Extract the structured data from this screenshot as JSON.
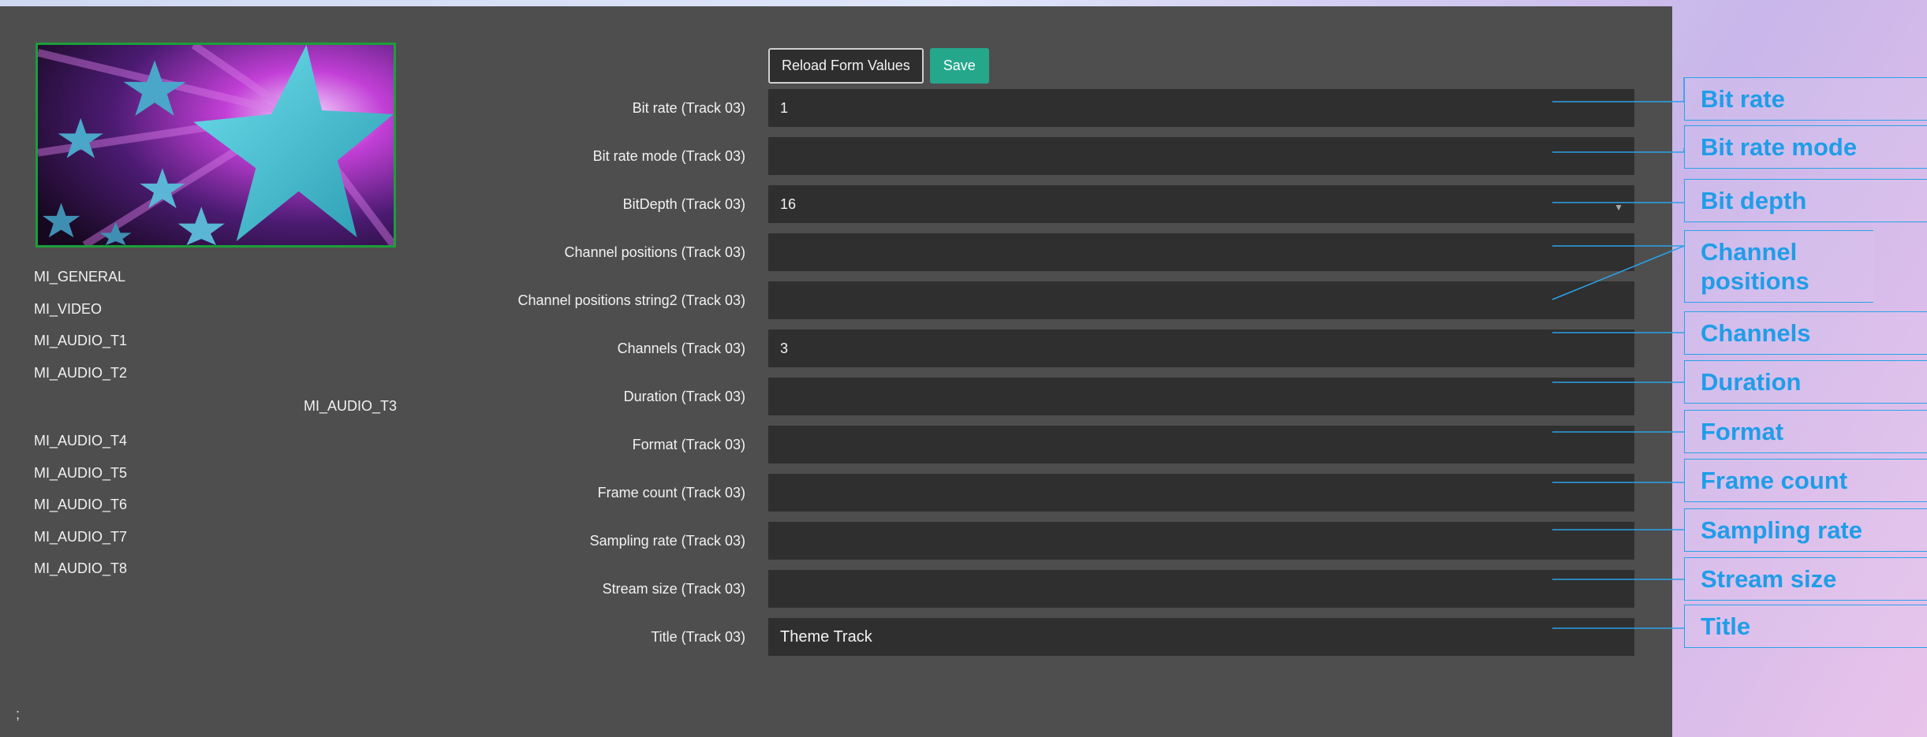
{
  "sidebar": {
    "items": [
      "MI_GENERAL",
      "MI_VIDEO",
      "MI_AUDIO_T1",
      "MI_AUDIO_T2",
      "MI_AUDIO_T3",
      "MI_AUDIO_T4",
      "MI_AUDIO_T5",
      "MI_AUDIO_T6",
      "MI_AUDIO_T7",
      "MI_AUDIO_T8"
    ]
  },
  "toolbar": {
    "reload_label": "Reload Form Values",
    "save_label": "Save"
  },
  "form": {
    "fields": [
      {
        "label": "Bit rate (Track 03)",
        "value": "1"
      },
      {
        "label": "Bit rate mode (Track 03)",
        "value": ""
      },
      {
        "label": "BitDepth (Track 03)",
        "value": "16"
      },
      {
        "label": "Channel positions (Track 03)",
        "value": ""
      },
      {
        "label": "Channel positions string2 (Track 03)",
        "value": ""
      },
      {
        "label": "Channels (Track 03)",
        "value": "3"
      },
      {
        "label": "Duration (Track 03)",
        "value": ""
      },
      {
        "label": "Format (Track 03)",
        "value": ""
      },
      {
        "label": "Frame count (Track 03)",
        "value": ""
      },
      {
        "label": "Sampling rate (Track 03)",
        "value": ""
      },
      {
        "label": "Stream size (Track 03)",
        "value": ""
      },
      {
        "label": "Title (Track 03)",
        "value": "Theme Track"
      }
    ]
  },
  "callouts": [
    "Bit rate",
    "Bit rate mode",
    "Bit depth",
    "Channel positions",
    "Channels",
    "Duration",
    "Format",
    "Frame count",
    "Sampling rate",
    "Stream size",
    "Title"
  ],
  "footer": {
    "text": ";"
  },
  "colors": {
    "panel": "#4e4e4e",
    "field": "#2f2f2f",
    "save": "#25a78c",
    "callout": "#1f9de8",
    "thumb_border": "#1c9f3a"
  },
  "icons": {
    "bitdepth_select": "chevron-down-icon"
  }
}
